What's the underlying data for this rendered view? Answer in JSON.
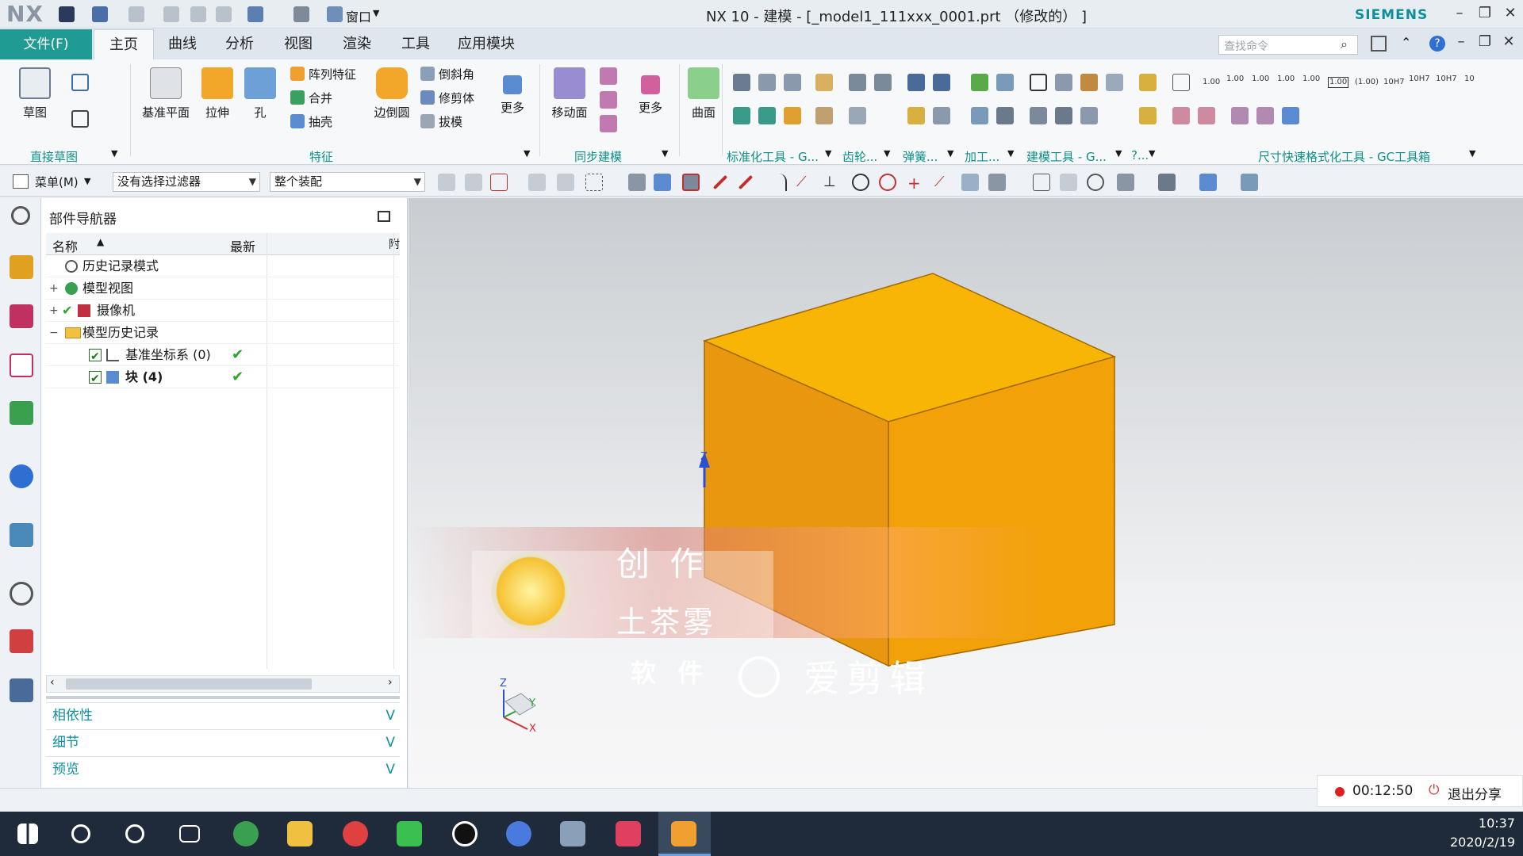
{
  "app": {
    "logo": "NX",
    "title": "NX 10 - 建模 - [_model1_111xxx_0001.prt （修改的） ]",
    "brand": "SIEMENS",
    "window_menu": "窗口"
  },
  "tabs": {
    "file": "文件(F)",
    "items": [
      "主页",
      "曲线",
      "分析",
      "视图",
      "渲染",
      "工具",
      "应用模块"
    ],
    "active": "主页"
  },
  "search": {
    "placeholder": "查找命令"
  },
  "ribbon": {
    "sketch": "草图",
    "datum_plane": "基准平面",
    "extrude": "拉伸",
    "hole": "孔",
    "pattern_feature": "阵列特征",
    "unite": "合并",
    "shell": "抽壳",
    "edge_blend": "边倒圆",
    "chamfer": "倒斜角",
    "trim_body": "修剪体",
    "draft": "拔模",
    "more1": "更多",
    "move_face": "移动面",
    "more2": "更多",
    "surface": "曲面",
    "groups": {
      "direct_sketch": "直接草图",
      "feature": "特征",
      "sync_modeling": "同步建模",
      "standard_tools": "标准化工具 - G...",
      "gear": "齿轮...",
      "spring": "弹簧...",
      "machining": "加工...",
      "modeling_tools": "建模工具 - G...",
      "dots": "?...",
      "dim_format": "尺寸快速格式化工具 - GC工具箱"
    },
    "dim_values": [
      "1.00",
      "1.00",
      "1.00",
      "1.00",
      "1.00",
      "1.00",
      "(1.00)",
      "10H7",
      "10H7",
      "10H7",
      "10"
    ]
  },
  "cmdbar": {
    "menu": "菜单(M)",
    "filter": "没有选择过滤器",
    "assembly": "整个装配"
  },
  "navigator": {
    "title": "部件导航器",
    "col_name": "名称",
    "col_latest": "最新",
    "col_extra": "附",
    "rows": [
      {
        "label": "历史记录模式",
        "latest": ""
      },
      {
        "label": "模型视图",
        "latest": ""
      },
      {
        "label": "摄像机",
        "latest": ""
      },
      {
        "label": "模型历史记录",
        "latest": ""
      },
      {
        "label": "基准坐标系 (0)",
        "latest": "✔"
      },
      {
        "label": "块 (4)",
        "latest": "✔"
      }
    ],
    "panels": [
      "相依性",
      "细节",
      "预览"
    ]
  },
  "overlay": {
    "line1": "创 作",
    "line2": "土茶雾",
    "line3": "软 件",
    "brand": "爱剪辑"
  },
  "axes": {
    "z": "Z",
    "y": "Y",
    "x": "X"
  },
  "recording": {
    "time": "00:12:50",
    "exit": "退出分享"
  },
  "clock": {
    "time": "10:37",
    "date": "2020/2/19"
  },
  "colors": {
    "accent": "#1f9b93",
    "cube_top": "#f9b506",
    "cube_front": "#e9970f",
    "cube_right": "#f2a109",
    "taskbar": "#1f2b3a"
  }
}
